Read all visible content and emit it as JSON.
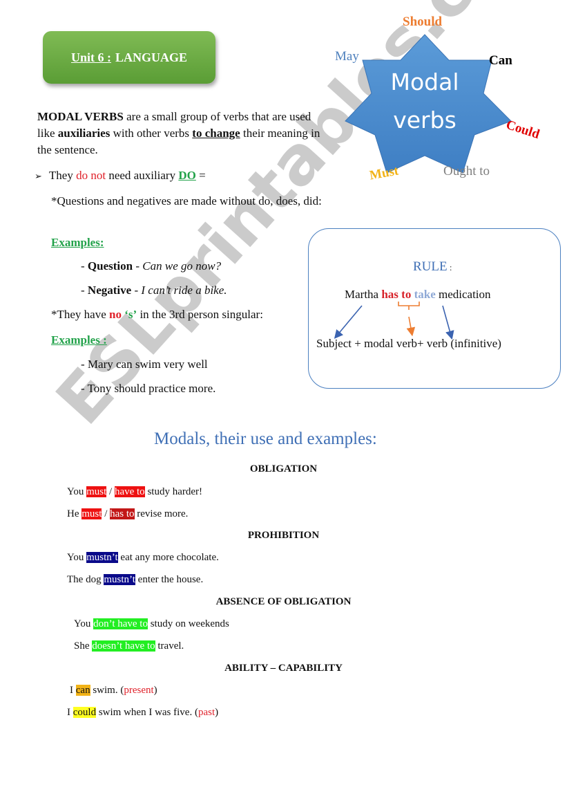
{
  "header": {
    "unit_prefix": "Unit 6 :",
    "unit_title": "LANGUAGE"
  },
  "star": {
    "center_line1": "Modal",
    "center_line2": "verbs",
    "labels": {
      "should": "Should",
      "may": "May",
      "can": "Can",
      "could": "Could",
      "must": "Must",
      "ought_to": "Ought to"
    },
    "colors": {
      "fill": "#4f8fd2",
      "should": "#ed7d31",
      "may": "#4f81bd",
      "can": "#000000",
      "could": "#e00000",
      "must": "#f2b318",
      "ought_to": "#7f7f7f"
    }
  },
  "intro": {
    "term": "MODAL VERBS",
    "p1": " are a small group of verbs that are used like ",
    "aux": "auxiliaries",
    "p2": " with other verbs ",
    "change": "to change",
    "p3": " their meaning in the sentence."
  },
  "bullet": {
    "p1": "They ",
    "do_not": "do not",
    "p2": " need auxiliary ",
    "do": "DO",
    "p3": "  ="
  },
  "questions_note": "*Questions and negatives are made without  do, does, did:",
  "examples1": {
    "heading": "Examples:",
    "q_label": "Question",
    "q_text": "Can we go now?",
    "n_label": "Negative",
    "n_text": "I can’t ride a bike."
  },
  "third_person": {
    "p1": "*They have ",
    "no": "no",
    "s": "‘s’",
    "p2": "  in the 3rd person singular:"
  },
  "examples2": {
    "heading": "Examples :",
    "items": [
      "- Mary can swim very well",
      "- Tony should practice more."
    ]
  },
  "rule": {
    "title": "RULE",
    "colon": " :",
    "sentence": {
      "subject": "Martha ",
      "modal": "has to",
      "verb": "take",
      "rest": " medication"
    },
    "formula": "Subject + modal verb+ verb (infinitive)"
  },
  "section_title": "Modals, their use and examples:",
  "categories": {
    "obligation": {
      "title": "OBLIGATION",
      "ex1": {
        "a": "You ",
        "m1": "must",
        "sep": " / ",
        "m2": "have to",
        "b": " study harder!"
      },
      "ex2": {
        "a": "He ",
        "m1": "must",
        "sep": " / ",
        "m2": "has to",
        "b": " revise more."
      }
    },
    "prohibition": {
      "title": "PROHIBITION",
      "ex1": {
        "a": "You ",
        "m": "mustn’t",
        "b": " eat any more chocolate."
      },
      "ex2": {
        "a": "The dog ",
        "m": "mustn’t",
        "b": " enter the house."
      }
    },
    "absence": {
      "title": "ABSENCE OF OBLIGATION",
      "ex1": {
        "a": "You ",
        "m": "don’t have to",
        "b": " study on weekends"
      },
      "ex2": {
        "a": "She ",
        "m": "doesn’t have to",
        "b": " travel."
      }
    },
    "ability": {
      "title": "ABILITY – CAPABILITY",
      "ex1": {
        "a": "I ",
        "m": "can",
        "b": " swim.  (",
        "tense": "present",
        "c": ")"
      },
      "ex2": {
        "a": "I ",
        "m": "could",
        "b": " swim when I was five.  (",
        "tense": "past",
        "c": ")"
      }
    }
  },
  "watermark": "ESLprintables.com"
}
